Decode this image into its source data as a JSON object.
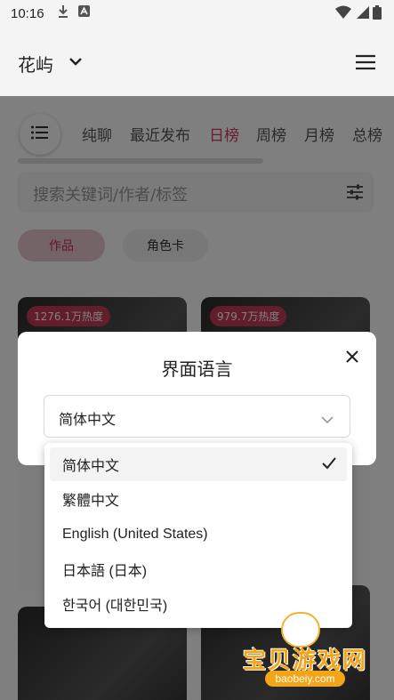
{
  "status_bar": {
    "time": "10:16"
  },
  "header": {
    "site_name": "花屿"
  },
  "tabs": [
    {
      "label": "纯聊"
    },
    {
      "label": "最近发布"
    },
    {
      "label": "日榜"
    },
    {
      "label": "周榜"
    },
    {
      "label": "月榜"
    },
    {
      "label": "总榜"
    }
  ],
  "search": {
    "placeholder": "搜索关键词/作者/标签"
  },
  "filter_chips": [
    {
      "label": "作品"
    },
    {
      "label": "角色卡"
    }
  ],
  "cards": [
    {
      "heat": "1276.1万热度"
    },
    {
      "heat": "979.7万热度"
    }
  ],
  "dialog": {
    "title": "界面语言",
    "selected_value": "简体中文"
  },
  "language_options": [
    {
      "label": "简体中文",
      "selected": true
    },
    {
      "label": "繁體中文",
      "selected": false
    },
    {
      "label": "English (United States)",
      "selected": false
    },
    {
      "label": "日本語 (日本)",
      "selected": false
    },
    {
      "label": "한국어 (대한민국)",
      "selected": false
    }
  ],
  "watermark": {
    "brand": "宝贝游戏网",
    "url": "baobeiy.com"
  },
  "colors": {
    "accent": "#d33a5d",
    "watermark": "#f4a417"
  }
}
